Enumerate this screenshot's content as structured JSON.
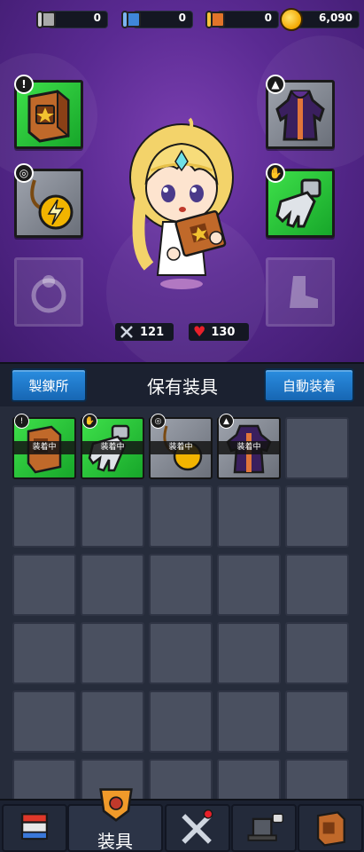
{
  "currency": [
    {
      "name": "grey-scroll-icon",
      "value": "0",
      "color": "#a9a9a9"
    },
    {
      "name": "blue-scroll-icon",
      "value": "0",
      "color": "#3f86d8"
    },
    {
      "name": "orange-scroll-icon",
      "value": "0",
      "color": "#e2742a"
    },
    {
      "name": "coin-icon",
      "value": "6,090",
      "color": "#f2b400"
    }
  ],
  "stats": {
    "attack": "121",
    "hp": "130"
  },
  "inventory": {
    "forge_label": "製錬所",
    "title": "保有装具",
    "auto_equip_label": "自動装着",
    "equipped_badge": "装着中"
  },
  "nav": {
    "active_label": "装具"
  },
  "colors": {
    "rarity_green": "#2bc63b",
    "rarity_grey": "#8a8f99",
    "accent_blue": "#1f7bd0",
    "hero_purple": "#5a2a92"
  }
}
